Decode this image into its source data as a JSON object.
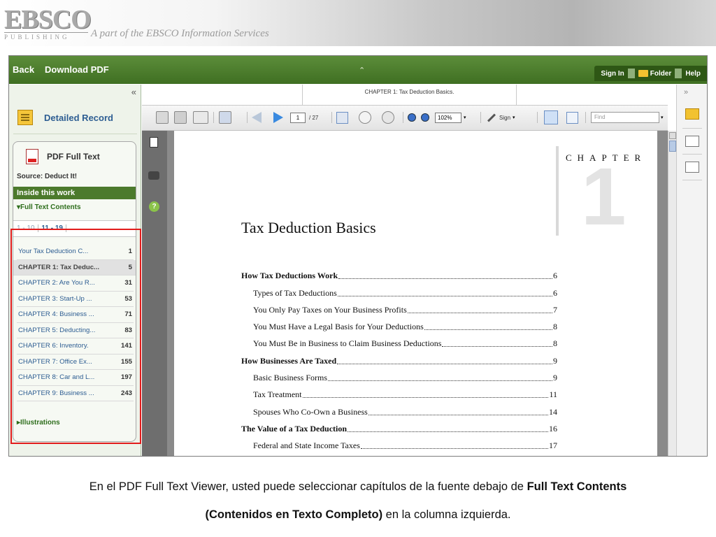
{
  "banner": {
    "logo_text": "EBSCO",
    "logo_sub": "PUBLISHING",
    "tagline": "A part of the EBSCO Information Services"
  },
  "topbar": {
    "back": "Back",
    "download_pdf": "Download PDF",
    "collapse_icon": "chevron-up-icon",
    "sign_in": "Sign In",
    "folder": "Folder",
    "help": "Help"
  },
  "left_panel": {
    "collapse": "«",
    "detailed_record": "Detailed Record",
    "pdf_full_text": "PDF Full Text",
    "source_label": "Source:",
    "source_value": "Deduct It!",
    "inside_this_work": "Inside this work",
    "full_text_contents": "▾Full Text Contents",
    "pager": {
      "range1": "1 - 10",
      "range2": "11 - 19"
    },
    "toc": [
      {
        "title": "Your Tax Deduction C...",
        "page": "1"
      },
      {
        "title": "CHAPTER 1: Tax Deduc...",
        "page": "5",
        "selected": true
      },
      {
        "title": "CHAPTER 2: Are You R...",
        "page": "31"
      },
      {
        "title": "CHAPTER 3: Start-Up ...",
        "page": "53"
      },
      {
        "title": "CHAPTER 4: Business ...",
        "page": "71"
      },
      {
        "title": "CHAPTER 5: Deducting...",
        "page": "83"
      },
      {
        "title": "CHAPTER 6: Inventory.",
        "page": "141"
      },
      {
        "title": "CHAPTER 7: Office Ex...",
        "page": "155"
      },
      {
        "title": "CHAPTER 8: Car and L...",
        "page": "197"
      },
      {
        "title": "CHAPTER 9: Business ...",
        "page": "243"
      }
    ],
    "illustrations": "▸Illustrations",
    "highlight_color": "#e21c1c"
  },
  "viewer": {
    "doc_tab": "CHAPTER 1: Tax Deduction Basics.",
    "expand_right": "»",
    "toolbar": {
      "page_current": "1",
      "page_total": "/ 27",
      "zoom": "102%",
      "sign": "Sign",
      "find_placeholder": "Find"
    },
    "page": {
      "chapter_word": "CHAPTER",
      "chapter_number": "1",
      "title": "Tax Deduction Basics",
      "toc": [
        {
          "label": "How Tax Deductions Work",
          "page": "6",
          "level": 0
        },
        {
          "label": "Types of Tax Deductions",
          "page": "6",
          "level": 1
        },
        {
          "label": "You Only Pay Taxes on Your Business Profits",
          "page": "7",
          "level": 1
        },
        {
          "label": "You Must Have a Legal Basis for Your Deductions",
          "page": "8",
          "level": 1
        },
        {
          "label": "You Must Be in Business to Claim Business Deductions",
          "page": "8",
          "level": 1
        },
        {
          "label": "How Businesses Are Taxed",
          "page": "9",
          "level": 0
        },
        {
          "label": "Basic Business Forms",
          "page": "9",
          "level": 1
        },
        {
          "label": "Tax Treatment",
          "page": "11",
          "level": 1
        },
        {
          "label": "Spouses Who Co-Own a Business",
          "page": "14",
          "level": 1
        },
        {
          "label": "The Value of a Tax Deduction",
          "page": "16",
          "level": 0
        },
        {
          "label": "Federal and State Income Taxes",
          "page": "17",
          "level": 1
        }
      ]
    }
  },
  "caption": {
    "line1_prefix": "En el PDF Full Text Viewer, usted puede seleccionar capítulos de la fuente debajo de ",
    "line1_bold": "Full Text Contents",
    "line2_bold": "(Contenidos en Texto Completo)",
    "line2_suffix": " en la columna izquierda."
  },
  "colors": {
    "green_bar": "#4c7a2c",
    "link_blue": "#2d5d92"
  }
}
